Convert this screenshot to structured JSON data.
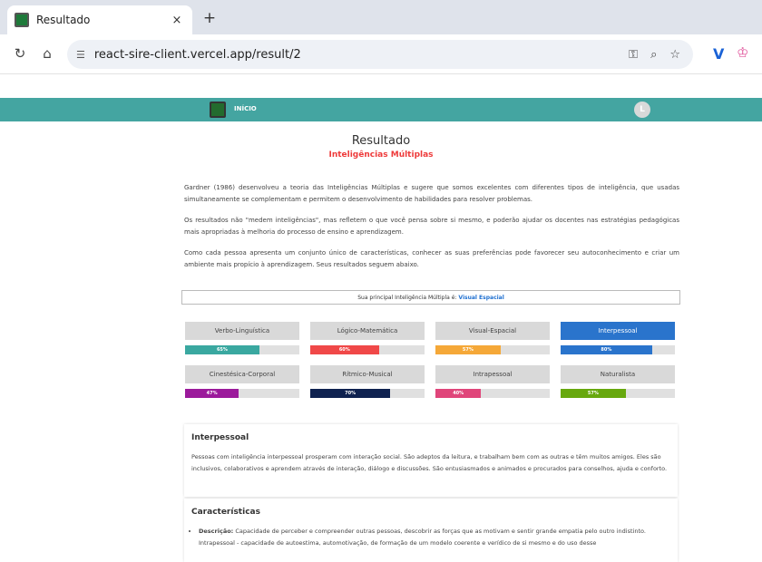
{
  "browser": {
    "tab_title": "Resultado",
    "tab_close": "×",
    "new_tab": "+",
    "url": "react-sire-client.vercel.app/result/2"
  },
  "header": {
    "nav_label": "INÍCIO",
    "avatar_initial": "L",
    "bg_color": "#44a5a1"
  },
  "page": {
    "title": "Resultado",
    "subtitle": "Inteligências Múltiplas",
    "paragraphs": [
      "Gardner (1986) desenvolveu a teoria das Inteligências Múltiplas e sugere que somos excelentes com diferentes tipos de inteligência, que usadas simultaneamente se complementam e permitem o desenvolvimento de habilidades para resolver problemas.",
      "Os resultados não \"medem inteligências\", mas refletem o que você pensa sobre si mesmo, e poderão ajudar os docentes nas estratégias pedagógicas mais apropriadas à melhoria do processo de ensino e aprendizagem.",
      "Como cada pessoa apresenta um conjunto único de características, conhecer as suas preferências pode favorecer seu autoconhecimento e criar um ambiente mais propício à aprendizagem. Seus resultados seguem abaixo."
    ],
    "principal_prefix": "Sua principal Inteligência Múltipla é:",
    "principal_value": "Visual Espacial"
  },
  "intelligences": [
    {
      "label": "Verbo-Linguística",
      "percent": 65,
      "percent_label": "65%",
      "color": "#3aa8a0",
      "active": false
    },
    {
      "label": "Lógico-Matemática",
      "percent": 60,
      "percent_label": "60%",
      "color": "#f04848",
      "active": false
    },
    {
      "label": "Visual-Espacial",
      "percent": 57,
      "percent_label": "57%",
      "color": "#f5a838",
      "active": false
    },
    {
      "label": "Interpessoal",
      "percent": 80,
      "percent_label": "80%",
      "color": "#2a74cc",
      "active": true
    },
    {
      "label": "Cinestésica-Corporal",
      "percent": 47,
      "percent_label": "47%",
      "color": "#9b1a9b",
      "active": false
    },
    {
      "label": "Rítmico-Musical",
      "percent": 70,
      "percent_label": "70%",
      "color": "#0f2250",
      "active": false
    },
    {
      "label": "Intrapessoal",
      "percent": 40,
      "percent_label": "40%",
      "color": "#e0457a",
      "active": false
    },
    {
      "label": "Naturalista",
      "percent": 57,
      "percent_label": "57%",
      "color": "#67a80e",
      "active": false
    }
  ],
  "detail": {
    "title": "Interpessoal",
    "text": "Pessoas com inteligência interpessoal prosperam com interação social. São adeptos da leitura, e trabalham bem com as outras e têm muitos amigos. Eles são inclusivos, colaborativos e aprendem através de interação, diálogo e discussões. São entusiasmados e animados e procurados para conselhos, ajuda e conforto."
  },
  "characteristics": {
    "title": "Características",
    "item_label": "Descrição:",
    "item_text": "Capacidade de perceber e compreender outras pessoas, descobrir as forças que as motivam e sentir grande empatia pelo outro indistinto. Intrapessoal - capacidade de autoestima, automotivação, de formação de um modelo coerente e verídico de si mesmo e do uso desse"
  }
}
